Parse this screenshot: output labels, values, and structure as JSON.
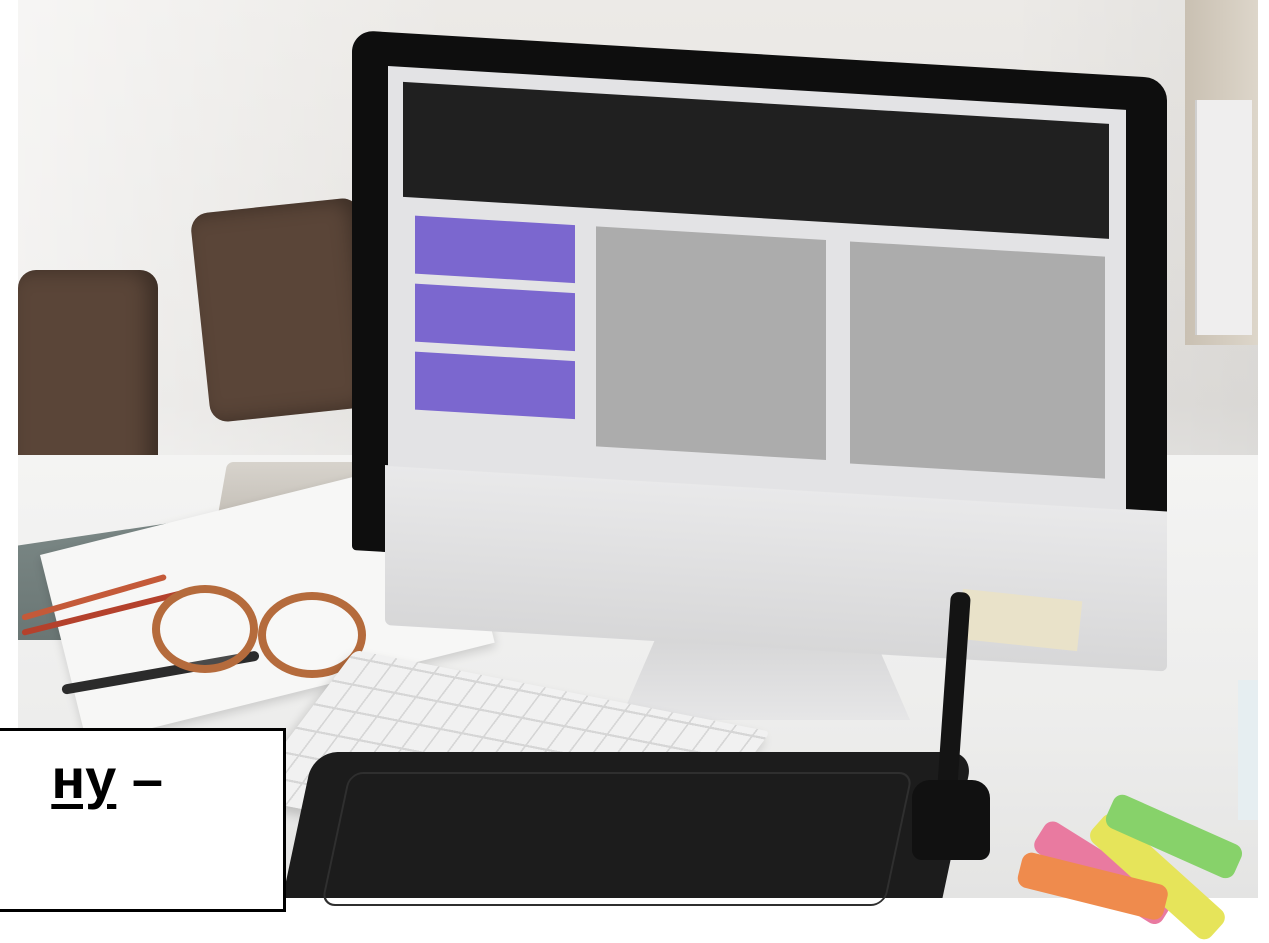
{
  "caption": {
    "underlined_text": "ну",
    "trailing_text": " –"
  },
  "screen_mockup": {
    "header_color": "#202020",
    "nav_item_color": "#7b67cf",
    "panel_color": "#acacac",
    "nav_items_count": 3,
    "panels_count": 2
  }
}
